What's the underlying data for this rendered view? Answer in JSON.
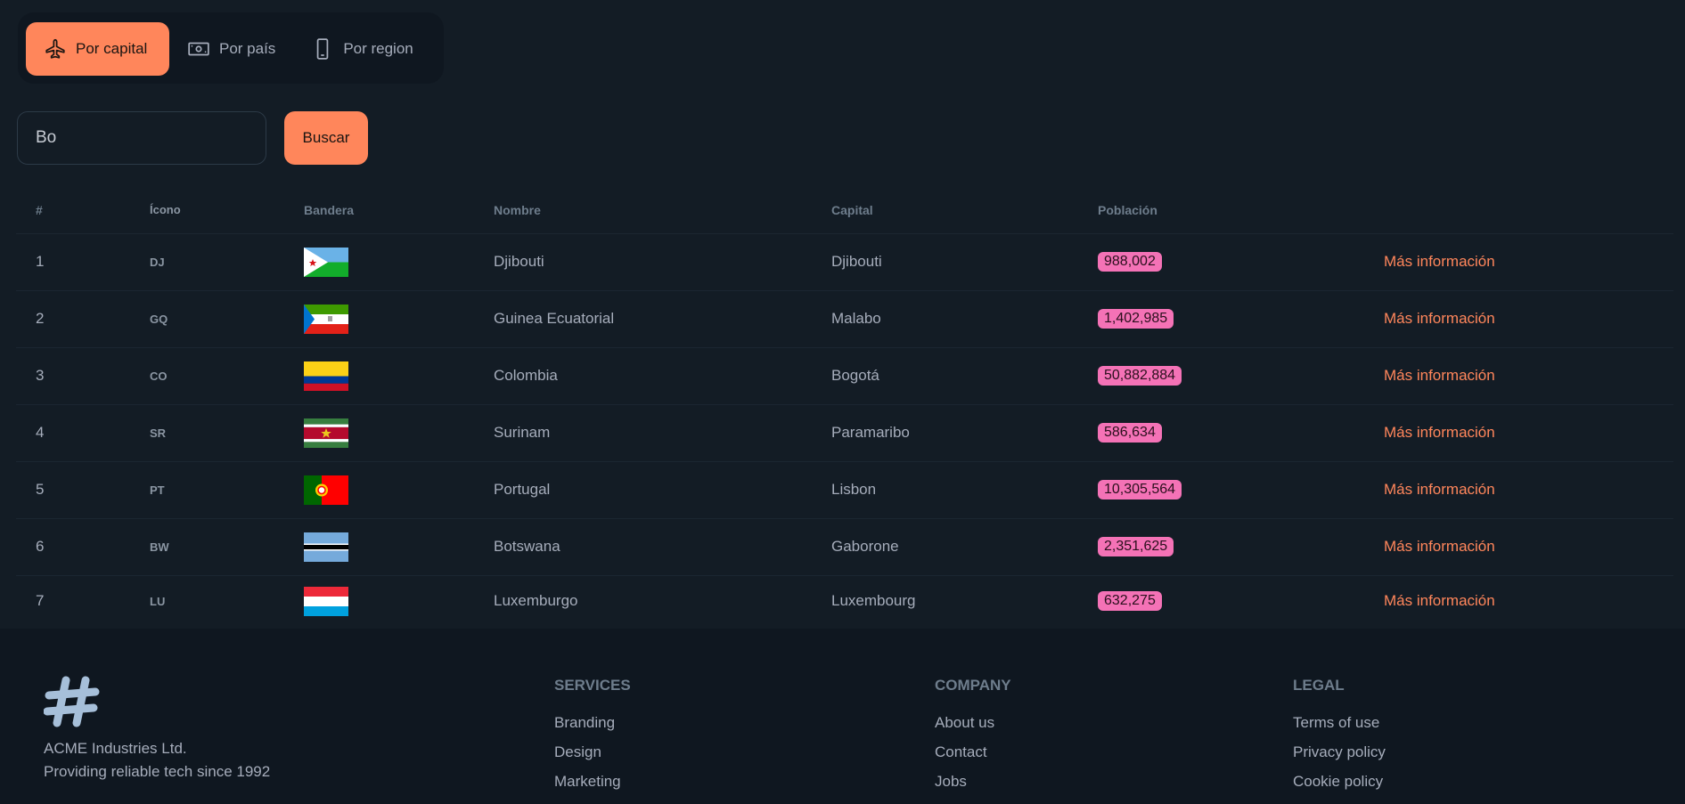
{
  "tabs": [
    {
      "label": "Por capital",
      "icon": "airplane-icon",
      "active": true
    },
    {
      "label": "Por país",
      "icon": "banknote-icon",
      "active": false
    },
    {
      "label": "Por region",
      "icon": "phone-icon",
      "active": false
    }
  ],
  "search": {
    "value": "Bo",
    "button_label": "Buscar"
  },
  "table": {
    "headers": [
      "#",
      "Ícono",
      "Bandera",
      "Nombre",
      "Capital",
      "Población",
      ""
    ],
    "link_label": "Más información",
    "rows": [
      {
        "num": "1",
        "code": "DJ",
        "flag": "djibouti-flag",
        "name": "Djibouti",
        "capital": "Djibouti",
        "population": "988,002"
      },
      {
        "num": "2",
        "code": "GQ",
        "flag": "equatorial-guinea-flag",
        "name": "Guinea Ecuatorial",
        "capital": "Malabo",
        "population": "1,402,985"
      },
      {
        "num": "3",
        "code": "CO",
        "flag": "colombia-flag",
        "name": "Colombia",
        "capital": "Bogotá",
        "population": "50,882,884"
      },
      {
        "num": "4",
        "code": "SR",
        "flag": "suriname-flag",
        "name": "Surinam",
        "capital": "Paramaribo",
        "population": "586,634"
      },
      {
        "num": "5",
        "code": "PT",
        "flag": "portugal-flag",
        "name": "Portugal",
        "capital": "Lisbon",
        "population": "10,305,564"
      },
      {
        "num": "6",
        "code": "BW",
        "flag": "botswana-flag",
        "name": "Botswana",
        "capital": "Gaborone",
        "population": "2,351,625"
      },
      {
        "num": "7",
        "code": "LU",
        "flag": "luxembourg-flag",
        "name": "Luxemburgo",
        "capital": "Luxembourg",
        "population": "632,275"
      }
    ]
  },
  "footer": {
    "brand_icon": "hashtag-logo-icon",
    "brand_name": "ACME Industries Ltd.",
    "brand_tagline": "Providing reliable tech since 1992",
    "columns": [
      {
        "title": "SERVICES",
        "links": [
          "Branding",
          "Design",
          "Marketing"
        ]
      },
      {
        "title": "COMPANY",
        "links": [
          "About us",
          "Contact",
          "Jobs"
        ]
      },
      {
        "title": "LEGAL",
        "links": [
          "Terms of use",
          "Privacy policy",
          "Cookie policy"
        ]
      }
    ]
  },
  "colors": {
    "accent": "#ff865b",
    "badge": "#f472b6",
    "background": "#131c25",
    "panel": "#0f1720"
  }
}
